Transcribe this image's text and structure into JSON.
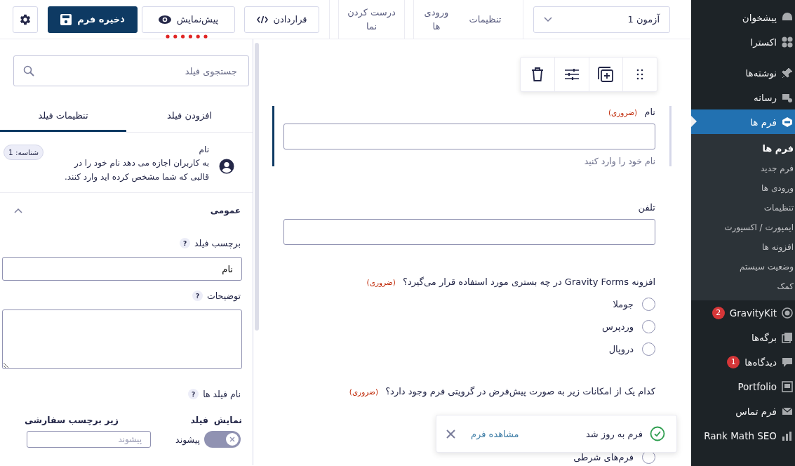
{
  "toolbar": {
    "form_select": {
      "value": "آزمون 1"
    },
    "links": [
      "تنظیمات",
      "ورودی ها",
      "درست کردن نما"
    ],
    "buttons": [
      {
        "kind": "embed",
        "label": "قراردادن"
      },
      {
        "kind": "preview",
        "label": "پیش‌نمایش"
      },
      {
        "kind": "save",
        "label": "ذخیره فرم"
      },
      {
        "kind": "settings"
      }
    ]
  },
  "sidebar": {
    "search": {
      "placeholder": "جستجوی فیلد"
    },
    "tabs": [
      {
        "label": "افزودن فیلد",
        "selected": false
      },
      {
        "label": "تنظیمات فیلد",
        "selected": true
      }
    ],
    "field_info": {
      "title": "نام",
      "description": "به کاربران اجازه می دهد نام خود را در قالبی که شما مشخص کرده اید وارد کنند.",
      "id_badge": "شناسه: 1"
    },
    "section": {
      "title": "عمومی",
      "expanded": true
    },
    "label_setting": {
      "label": "برچسب فیلد",
      "help": "?",
      "value": "نام"
    },
    "description_setting": {
      "label": "توضیحات",
      "help": "?"
    },
    "subfields": {
      "label": "نام فیلد ها",
      "help": "?",
      "columns": [
        "نمایش",
        "فیلد",
        "زیر برچسب سفارشی"
      ],
      "rows": [
        {
          "name": "پیشوند",
          "on": false,
          "placeholder": "پیشوند"
        }
      ]
    }
  },
  "canvas": {
    "fields": [
      {
        "kind": "text",
        "label": "نام",
        "required_note": "(ضروری)",
        "description": "نام خود را وارد کنید",
        "selected": true
      },
      {
        "kind": "text",
        "label": "تلفن",
        "selected": false
      },
      {
        "kind": "radio",
        "label": "افزونه Gravity Forms در چه بستری مورد استفاده قرار می‌گیرد؟",
        "required_note": "(ضروری)",
        "selected": false,
        "options": [
          {
            "label": "جوملا",
            "selected": false
          },
          {
            "label": "وردپرس",
            "selected": false
          },
          {
            "label": "دروپال",
            "selected": false
          }
        ]
      },
      {
        "kind": "radio",
        "label": "کدام یک از امکانات زیر به صورت پیش‌فرض در گرویتی فرم وجود دارد؟",
        "required_note": "(ضروری)",
        "selected": false,
        "options": [
          {
            "label": "فرم‌های شرطی",
            "selected": false
          }
        ]
      }
    ]
  },
  "toast": {
    "message": "فرم به روز شد",
    "link": "مشاهده فرم"
  },
  "admin_menu": {
    "items": [
      {
        "label": "پیشخوان",
        "selected": false
      },
      {
        "label": "اکسترا",
        "selected": false
      },
      {
        "label": "نوشته‌ها",
        "selected": false
      },
      {
        "label": "رسانه",
        "selected": false
      },
      {
        "label": "فرم ها",
        "selected": true,
        "children": [
          {
            "label": "فرم ها",
            "selected": true
          },
          {
            "label": "فرم جدید",
            "selected": false
          },
          {
            "label": "ورودی ها",
            "selected": false
          },
          {
            "label": "تنظیمات",
            "selected": false
          },
          {
            "label": "ایمپورت / اکسپورت",
            "selected": false
          },
          {
            "label": "افزونه ها",
            "selected": false
          },
          {
            "label": "وضعیت سیستم",
            "selected": false
          },
          {
            "label": "کمک",
            "selected": false
          }
        ]
      },
      {
        "label": "GravityKit",
        "badge": "2",
        "selected": false
      },
      {
        "label": "برگه‌ها",
        "selected": false
      },
      {
        "label": "دیدگاه‌ها",
        "badge": "1",
        "selected": false
      },
      {
        "label": "Portfolio",
        "selected": false
      },
      {
        "label": "فرم تماس",
        "selected": false
      },
      {
        "label": "Rank Math SEO",
        "selected": false
      }
    ]
  }
}
